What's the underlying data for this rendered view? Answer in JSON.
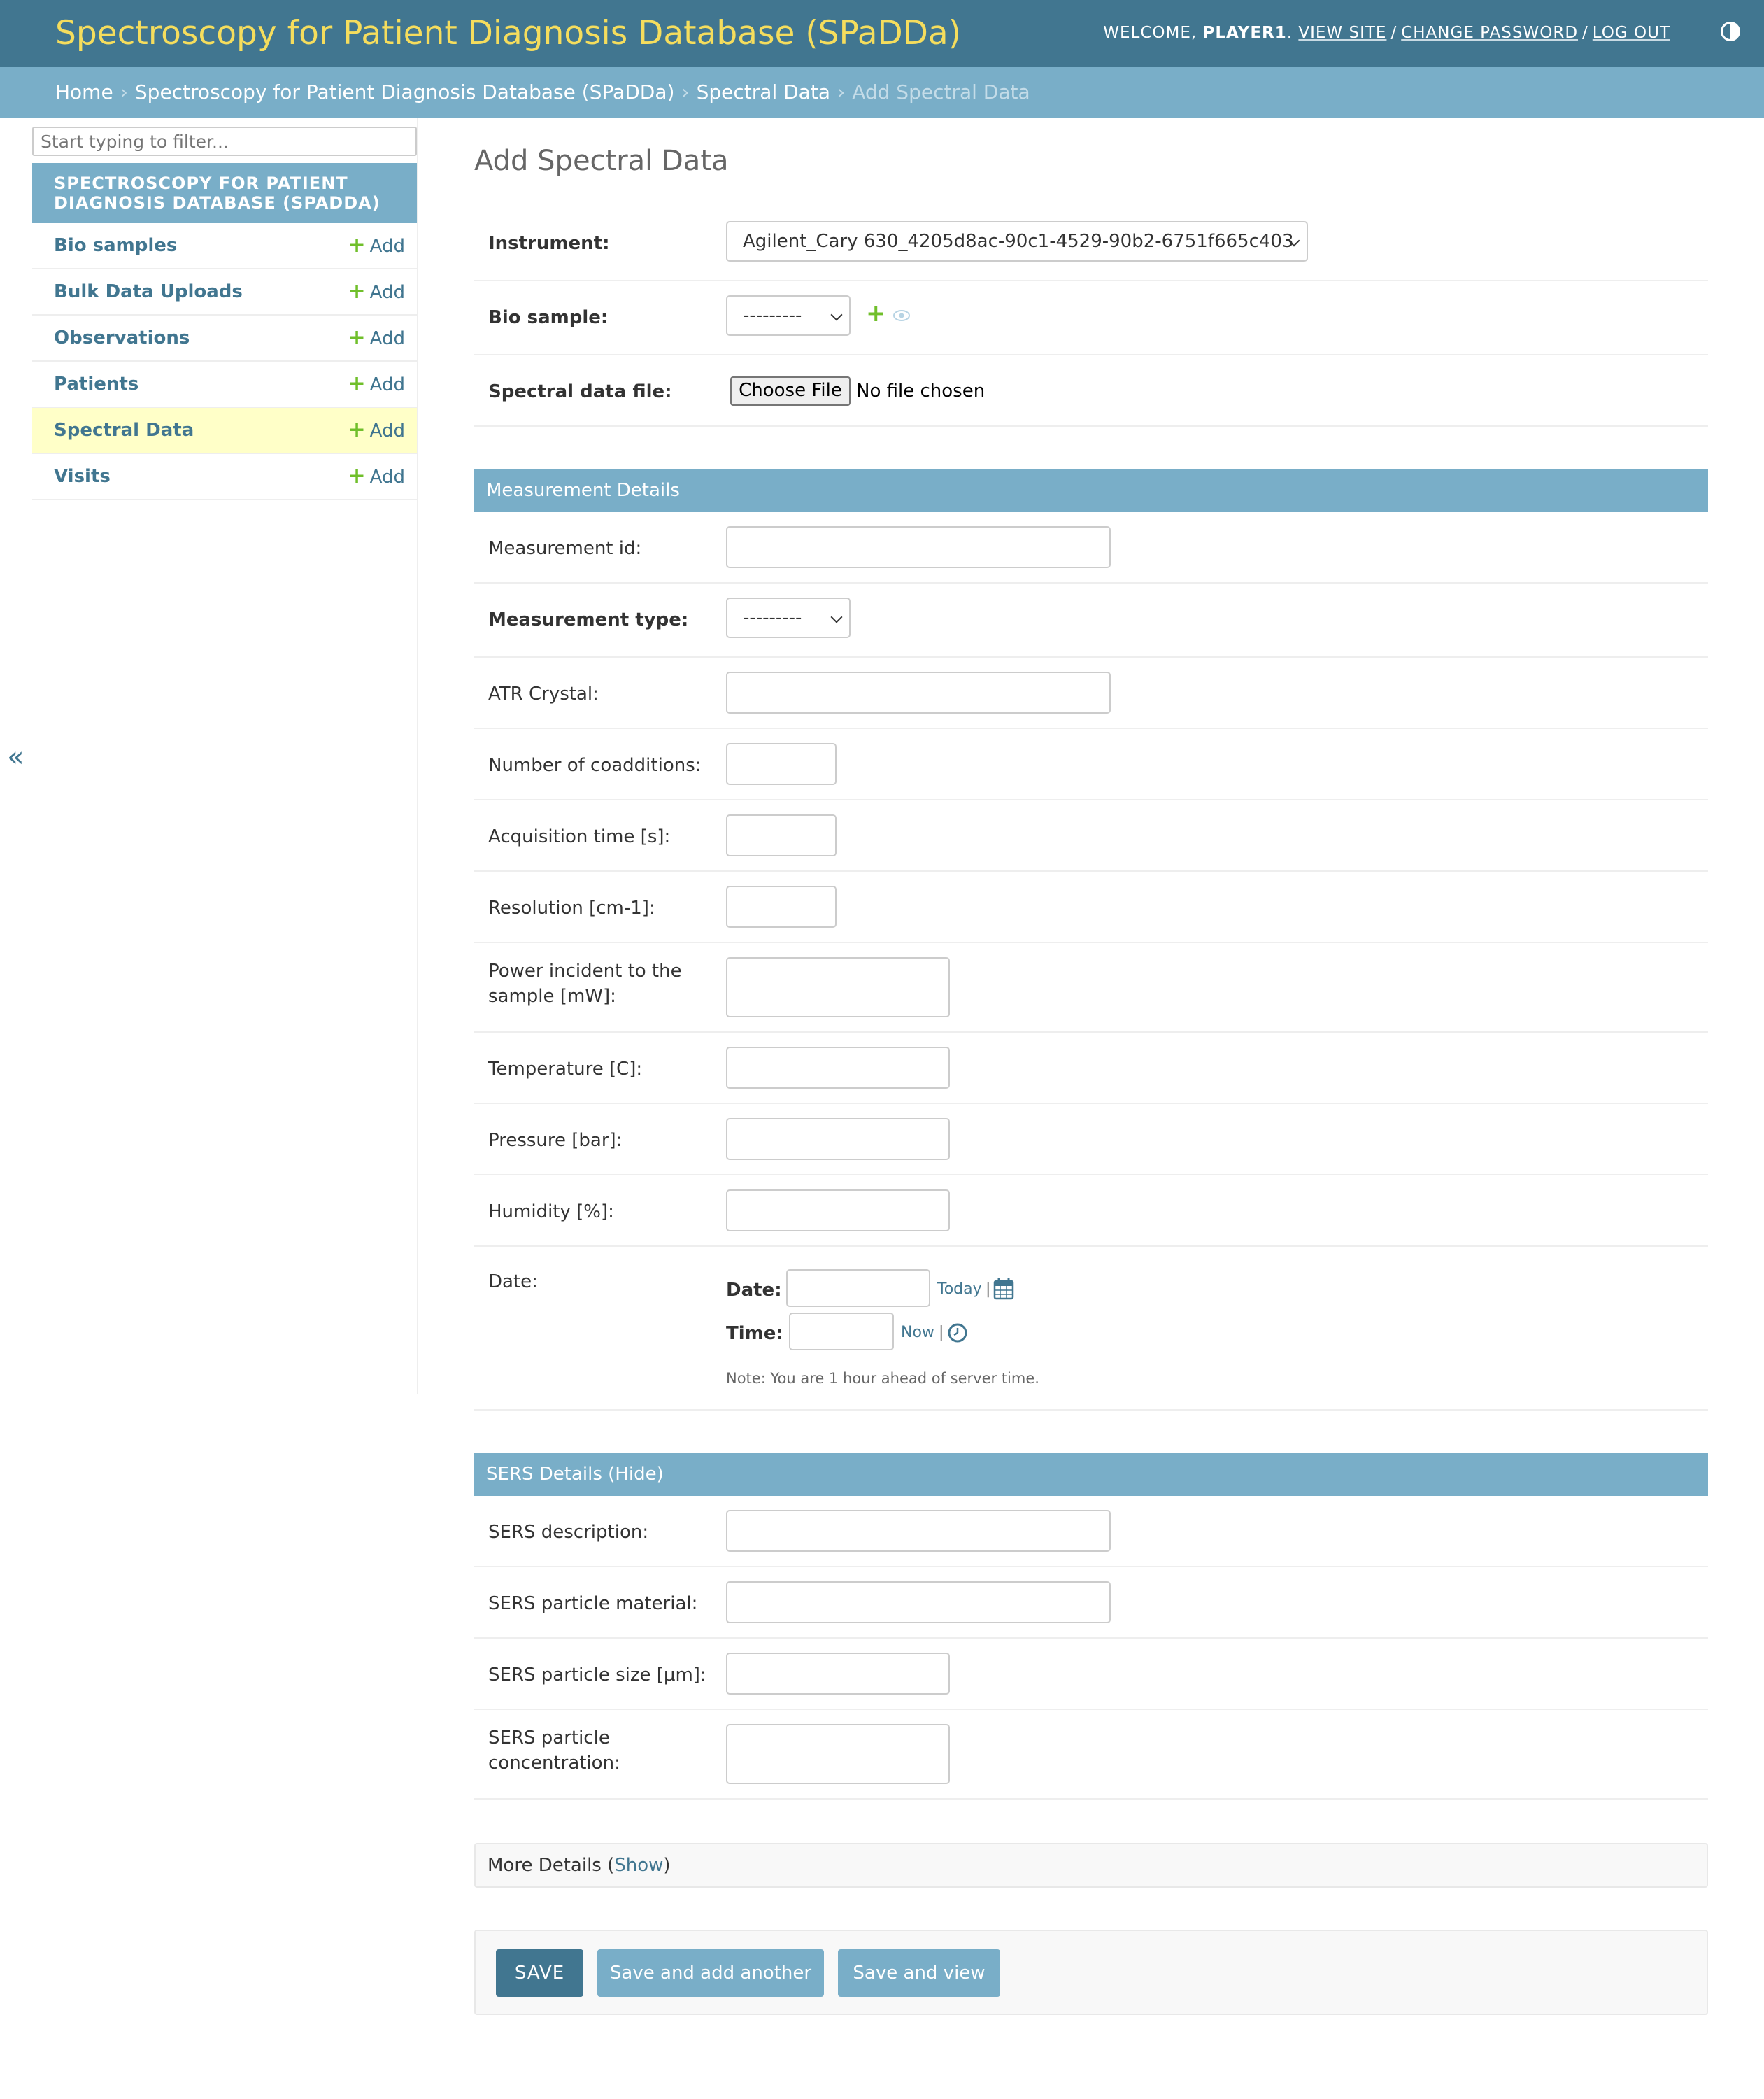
{
  "header": {
    "site_title": "Spectroscopy for Patient Diagnosis Database (SPaDDa)",
    "welcome_prefix": "WELCOME,",
    "username": "PLAYER1",
    "view_site": "VIEW SITE",
    "change_password": "CHANGE PASSWORD",
    "log_out": "LOG OUT",
    "separator": "/",
    "theme_toggle_icon": "half-circle-icon"
  },
  "breadcrumbs": {
    "home": "Home",
    "app": "Spectroscopy for Patient Diagnosis Database (SPaDDa)",
    "model": "Spectral Data",
    "current": "Add Spectral Data",
    "separator": "›"
  },
  "sidebar": {
    "filter_placeholder": "Start typing to filter...",
    "module_title": "SPECTROSCOPY FOR PATIENT DIAGNOSIS DATABASE (SPADDA)",
    "add_label": "Add",
    "items": [
      {
        "label": "Bio samples"
      },
      {
        "label": "Bulk Data Uploads"
      },
      {
        "label": "Observations"
      },
      {
        "label": "Patients"
      },
      {
        "label": "Spectral Data"
      },
      {
        "label": "Visits"
      }
    ],
    "active_item": "Spectral Data",
    "collapse_glyph": "«"
  },
  "main": {
    "title": "Add Spectral Data",
    "instrument": {
      "label": "Instrument:",
      "value": "Agilent_Cary 630_4205d8ac-90c1-4529-90b2-6751f665c403"
    },
    "bio_sample": {
      "label": "Bio sample:",
      "value": "---------"
    },
    "spectral_file": {
      "label": "Spectral data file:",
      "button": "Choose File",
      "status": "No file chosen"
    }
  },
  "measurement": {
    "section_title": "Measurement Details",
    "measurement_id": "Measurement id:",
    "measurement_type": {
      "label": "Measurement type:",
      "value": "---------"
    },
    "atr_crystal": "ATR Crystal:",
    "coadditions": "Number of coadditions:",
    "acquisition_time": "Acquisition time [s]:",
    "resolution": "Resolution [cm-1]:",
    "power": "Power incident to the sample [mW]:",
    "temperature": "Temperature [C]:",
    "pressure": "Pressure [bar]:",
    "humidity": "Humidity [%]:",
    "date": {
      "label": "Date:",
      "date_label": "Date:",
      "today": "Today",
      "time_label": "Time:",
      "now": "Now",
      "pipe": "|",
      "note": "Note: You are 1 hour ahead of server time."
    }
  },
  "sers": {
    "section_title": "SERS Details (Hide)",
    "description": "SERS description:",
    "material": "SERS particle material:",
    "size": "SERS particle size [μm]:",
    "concentration": "SERS particle concentration:"
  },
  "more_details": {
    "label": "More Details (",
    "show": "Show",
    "close": ")"
  },
  "buttons": {
    "save": "SAVE",
    "save_add_another": "Save and add another",
    "save_view": "Save and view"
  },
  "colors": {
    "header_bg": "#417690",
    "title_yellow": "#f5dd5d",
    "breadcrumb_bg": "#79aec8",
    "active_row": "#ffffc8",
    "add_green": "#70bf2b"
  }
}
